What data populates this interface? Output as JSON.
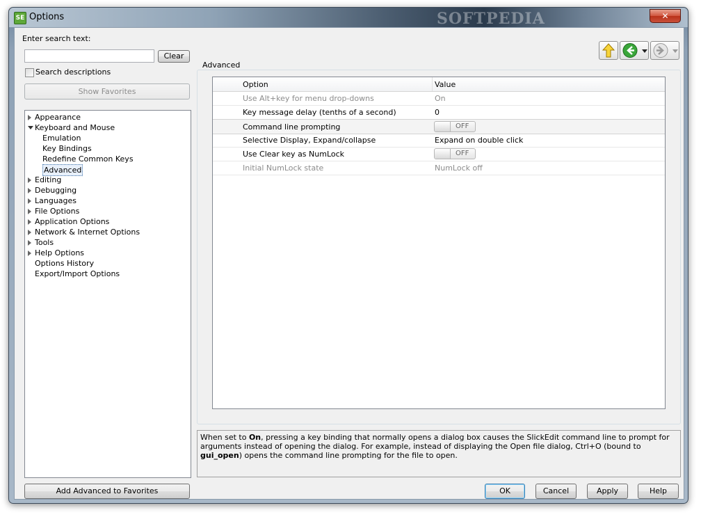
{
  "window": {
    "title": "Options",
    "app_icon_text": "SE",
    "close_symbol": "✕",
    "watermark": "SOFTPEDIA"
  },
  "search": {
    "label": "Enter search text:",
    "value": "",
    "placeholder": "",
    "clear_label": "Clear",
    "descriptions_label": "Search descriptions",
    "descriptions_checked": false
  },
  "favorites": {
    "show_label": "Show Favorites",
    "add_label": "Add Advanced to Favorites"
  },
  "tree": {
    "items": [
      {
        "label": "Appearance",
        "expander": "collapsed",
        "level": 0
      },
      {
        "label": "Keyboard and Mouse",
        "expander": "expanded",
        "level": 0
      },
      {
        "label": "Emulation",
        "expander": "none",
        "level": 1
      },
      {
        "label": "Key Bindings",
        "expander": "none",
        "level": 1
      },
      {
        "label": "Redefine Common Keys",
        "expander": "none",
        "level": 1
      },
      {
        "label": "Advanced",
        "expander": "none",
        "level": 1,
        "selected": true
      },
      {
        "label": "Editing",
        "expander": "collapsed",
        "level": 0
      },
      {
        "label": "Debugging",
        "expander": "collapsed",
        "level": 0
      },
      {
        "label": "Languages",
        "expander": "collapsed",
        "level": 0
      },
      {
        "label": "File Options",
        "expander": "collapsed",
        "level": 0
      },
      {
        "label": "Application Options",
        "expander": "collapsed",
        "level": 0
      },
      {
        "label": "Network & Internet Options",
        "expander": "collapsed",
        "level": 0
      },
      {
        "label": "Tools",
        "expander": "collapsed",
        "level": 0
      },
      {
        "label": "Help Options",
        "expander": "collapsed",
        "level": 0
      },
      {
        "label": "Options History",
        "expander": "none",
        "level": 0
      },
      {
        "label": "Export/Import Options",
        "expander": "none",
        "level": 0
      }
    ]
  },
  "nav": {
    "up_icon": "up-arrow-icon",
    "back_icon": "back-arrow-icon",
    "forward_icon": "forward-arrow-icon"
  },
  "panel": {
    "title": "Advanced",
    "columns": {
      "option": "Option",
      "value": "Value"
    },
    "rows": [
      {
        "option": "Use Alt+key for menu drop-downs",
        "value": "On",
        "kind": "text",
        "disabled": true
      },
      {
        "option": "Key message delay (tenths of a second)",
        "value": "0",
        "kind": "text",
        "disabled": false
      },
      {
        "option": "Command line prompting",
        "value": "OFF",
        "kind": "toggle",
        "disabled": false,
        "active": true
      },
      {
        "option": "Selective Display, Expand/collapse",
        "value": "Expand on double click",
        "kind": "text",
        "disabled": false
      },
      {
        "option": "Use Clear key as NumLock",
        "value": "OFF",
        "kind": "toggle",
        "disabled": false
      },
      {
        "option": "Initial NumLock state",
        "value": "NumLock off",
        "kind": "text",
        "disabled": true
      }
    ]
  },
  "description": {
    "part1": "When set to ",
    "bold1": "On",
    "part2": ", pressing a key binding that normally opens a dialog box causes the SlickEdit command line to prompt for arguments instead of opening the dialog. For example, instead of displaying the Open file dialog, Ctrl+O (bound to ",
    "bold2": "gui_open",
    "part3": ") opens the command line prompting for the file to open."
  },
  "buttons": {
    "ok": "OK",
    "cancel": "Cancel",
    "apply": "Apply",
    "help": "Help"
  },
  "colors": {
    "accent_up": "#f7d43a",
    "accent_back": "#3aa63a",
    "selection_border": "#3a6ea5"
  }
}
